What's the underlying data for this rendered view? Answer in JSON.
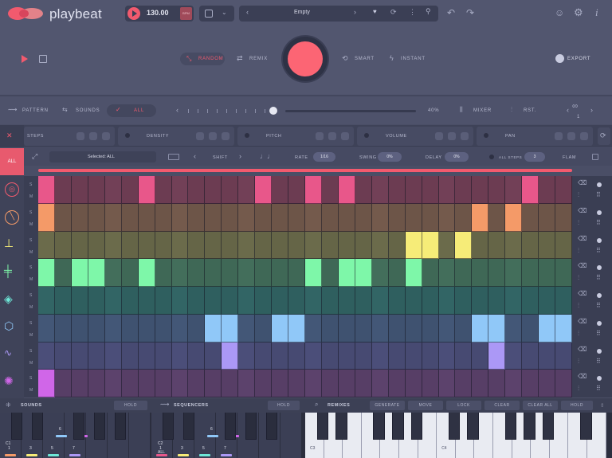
{
  "app": {
    "name": "playbeat"
  },
  "transport": {
    "bpm": "130.00",
    "tag": "BPM"
  },
  "preset": {
    "name": "Empty"
  },
  "modes": {
    "random": "RANDOM",
    "remix": "REMIX",
    "smart": "SMART",
    "instant": "INSTANT",
    "export": "EXPORT"
  },
  "toolbar": {
    "pattern": "PATTERN",
    "sounds": "SOUNDS",
    "all": "ALL",
    "percent": "40%",
    "mixer": "MIXER",
    "rst": "RST.",
    "count": "1"
  },
  "params": {
    "steps": "STEPS",
    "density": "DENSITY",
    "pitch": "PITCH",
    "volume": "VOLUME",
    "pan": "PAN"
  },
  "selection": {
    "all_btn": "ALL",
    "selected": "Selected: ALL",
    "shift": "SHIFT",
    "rate_label": "RATE",
    "rate": "1/16",
    "swing_label": "SWING",
    "swing": "0%",
    "delay_label": "DELAY",
    "delay": "0%",
    "all_steps_label": "ALL STEPS",
    "all_steps": "3",
    "flam": "FLAM"
  },
  "sm": {
    "s": "S",
    "m": "M"
  },
  "grid": {
    "rows": [
      {
        "dim": "#6c3c52",
        "bright": "#e8578a",
        "active": [
          0,
          6,
          13,
          16,
          18,
          29
        ]
      },
      {
        "dim": "#6d5548",
        "bright": "#f49a68",
        "active": [
          0,
          26,
          28
        ]
      },
      {
        "dim": "#656547",
        "bright": "#f6ec78",
        "active": [
          22,
          23,
          25
        ]
      },
      {
        "dim": "#3f6856",
        "bright": "#7ef7a9",
        "active": [
          0,
          2,
          3,
          6,
          16,
          18,
          19,
          22
        ]
      },
      {
        "dim": "#2f5f5f",
        "bright": "#6ee8d8",
        "active": []
      },
      {
        "dim": "#3f5270",
        "bright": "#90c8f8",
        "active": [
          10,
          11,
          14,
          15,
          26,
          27,
          30,
          31
        ]
      },
      {
        "dim": "#474a72",
        "bright": "#ab98f6",
        "active": [
          11,
          27
        ]
      },
      {
        "dim": "#573e66",
        "bright": "#d066e8",
        "active": [
          0
        ]
      }
    ]
  },
  "bottom": {
    "sounds": "SOUNDS",
    "hold1": "HOLD",
    "sequencers": "SEQUENCERS",
    "hold2": "HOLD",
    "remixes": "REMIXES",
    "generate": "GENERATE",
    "move": "MOVE",
    "lock": "LOCK",
    "clear": "CLEAR",
    "clear_all": "CLEAR ALL",
    "hold3": "HOLD"
  },
  "keyboard": {
    "pads1": [
      {
        "num": "1",
        "color": "#f49a68"
      },
      {
        "num": "2",
        "color": "#f49a68"
      },
      {
        "num": "3",
        "color": "#f6ec78"
      },
      {
        "num": "4",
        "color": "#7ef7a9"
      },
      {
        "num": "5",
        "color": "#6ee8d8"
      },
      {
        "num": "6",
        "color": "#90c8f8"
      },
      {
        "num": "7",
        "color": "#ab98f6"
      },
      {
        "num": "8",
        "color": "#d066e8"
      }
    ],
    "pads2": [
      {
        "num": "1",
        "color": "#e8578a"
      },
      {
        "num": "2",
        "color": "#f49a68"
      },
      {
        "num": "3",
        "color": "#f6ec78"
      },
      {
        "num": "4",
        "color": "#7ef7a9"
      },
      {
        "num": "5",
        "color": "#6ee8d8"
      },
      {
        "num": "6",
        "color": "#90c8f8"
      },
      {
        "num": "7",
        "color": "#ab98f6"
      },
      {
        "num": "8",
        "color": "#d066e8"
      }
    ],
    "c1": "C1",
    "c2": "C2",
    "all": "ALL",
    "c3": "C3",
    "c4": "C4"
  }
}
